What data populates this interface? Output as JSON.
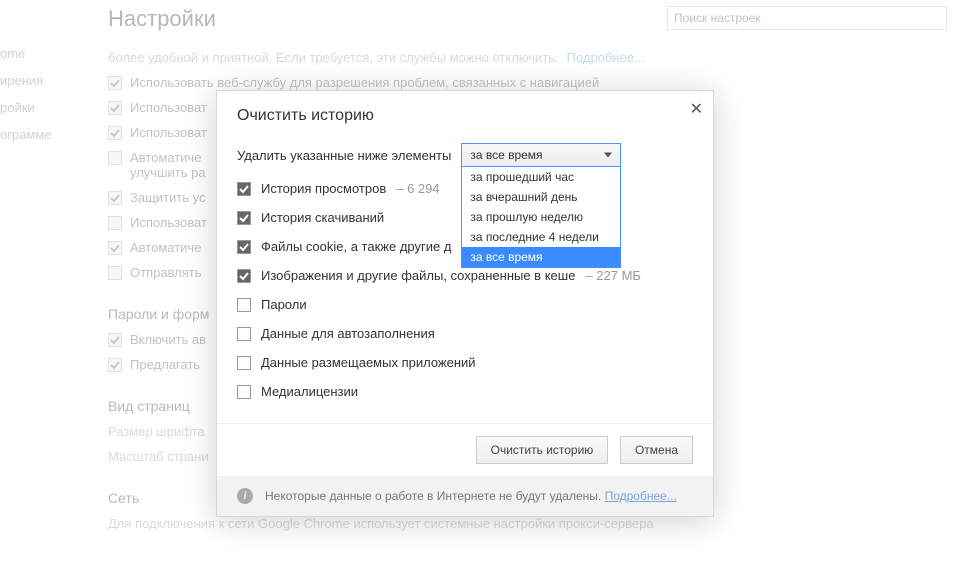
{
  "header": {
    "title": "Настройки"
  },
  "search": {
    "placeholder": "Поиск настроек"
  },
  "sidebar": {
    "items": [
      "ome",
      "ирения",
      "ройки",
      "ограмме"
    ]
  },
  "bg": {
    "topline_prefix": "более удобной и приятной. Если требуется, эти службы можно отключить.",
    "topline_link": "Подробнее...",
    "cb1": "Использовать веб-службу для разрешения проблем, связанных с навигацией",
    "cb2": "Использоват",
    "cb3": "Использоват",
    "cb4a": "Автоматиче",
    "cb4b": "улучшить ра",
    "cb5": "Защитить ус",
    "cb6": "Использоват",
    "cb7": "Автоматиче",
    "cb8": "Отправлять",
    "sec1": "Пароли и форм",
    "cb9": "Включить ав",
    "cb10": "Предлагать",
    "sec2": "Вид страниц",
    "t1": "Размер шрифта",
    "t2": "Масштаб страни",
    "sec3": "Сеть",
    "t3": "Для подключения к сети Google Chrome использует системные настройки прокси-сервера"
  },
  "dialog": {
    "title": "Очистить историю",
    "prompt": "Удалить указанные ниже элементы",
    "select_value": "за все время",
    "options": [
      "за прошедший час",
      "за вчерашний день",
      "за прошлую неделю",
      "за последние 4 недели",
      "за все время"
    ],
    "items": [
      {
        "label": "История просмотров",
        "hint": "– 6 294",
        "checked": true
      },
      {
        "label": "История скачиваний",
        "hint": "",
        "checked": true
      },
      {
        "label": "Файлы cookie, а также другие д",
        "hint": "",
        "checked": true
      },
      {
        "label": "Изображения и другие файлы, сохраненные в кеше",
        "hint": "– 227 МБ",
        "checked": true
      },
      {
        "label": "Пароли",
        "hint": "",
        "checked": false
      },
      {
        "label": "Данные для автозаполнения",
        "hint": "",
        "checked": false
      },
      {
        "label": "Данные размещаемых приложений",
        "hint": "",
        "checked": false
      },
      {
        "label": "Медиалицензии",
        "hint": "",
        "checked": false
      }
    ],
    "primary": "Очистить историю",
    "cancel": "Отмена",
    "info": "Некоторые данные о работе в Интернете не будут удалены.",
    "info_link": "Подробнее..."
  }
}
